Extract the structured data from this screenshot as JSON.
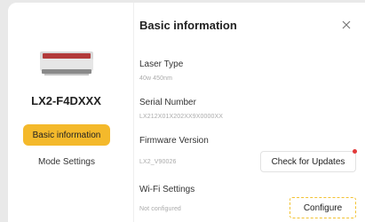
{
  "dialog": {
    "title": "Basic information",
    "close_icon": "close-icon"
  },
  "sidebar": {
    "device_name": "LX2-F4DXXX",
    "device_image": "laser-engraver-image",
    "items": [
      {
        "label": "Basic information",
        "active": true
      },
      {
        "label": "Mode Settings",
        "active": false
      }
    ]
  },
  "fields": {
    "laser_type": {
      "label": "Laser Type",
      "value": "40w 450nm"
    },
    "serial_number": {
      "label": "Serial Number",
      "value": "LX212X01X202XX9X0000XX"
    },
    "firmware_version": {
      "label": "Firmware Version",
      "value": "LX2_V90026"
    },
    "wifi_settings": {
      "label": "Wi-Fi Settings",
      "value": "Not configured"
    }
  },
  "buttons": {
    "check_updates": "Check for Updates",
    "configure": "Configure"
  },
  "colors": {
    "accent": "#f4b92b",
    "notification_dot": "#e23a3a",
    "configure_border": "#f2c233"
  }
}
